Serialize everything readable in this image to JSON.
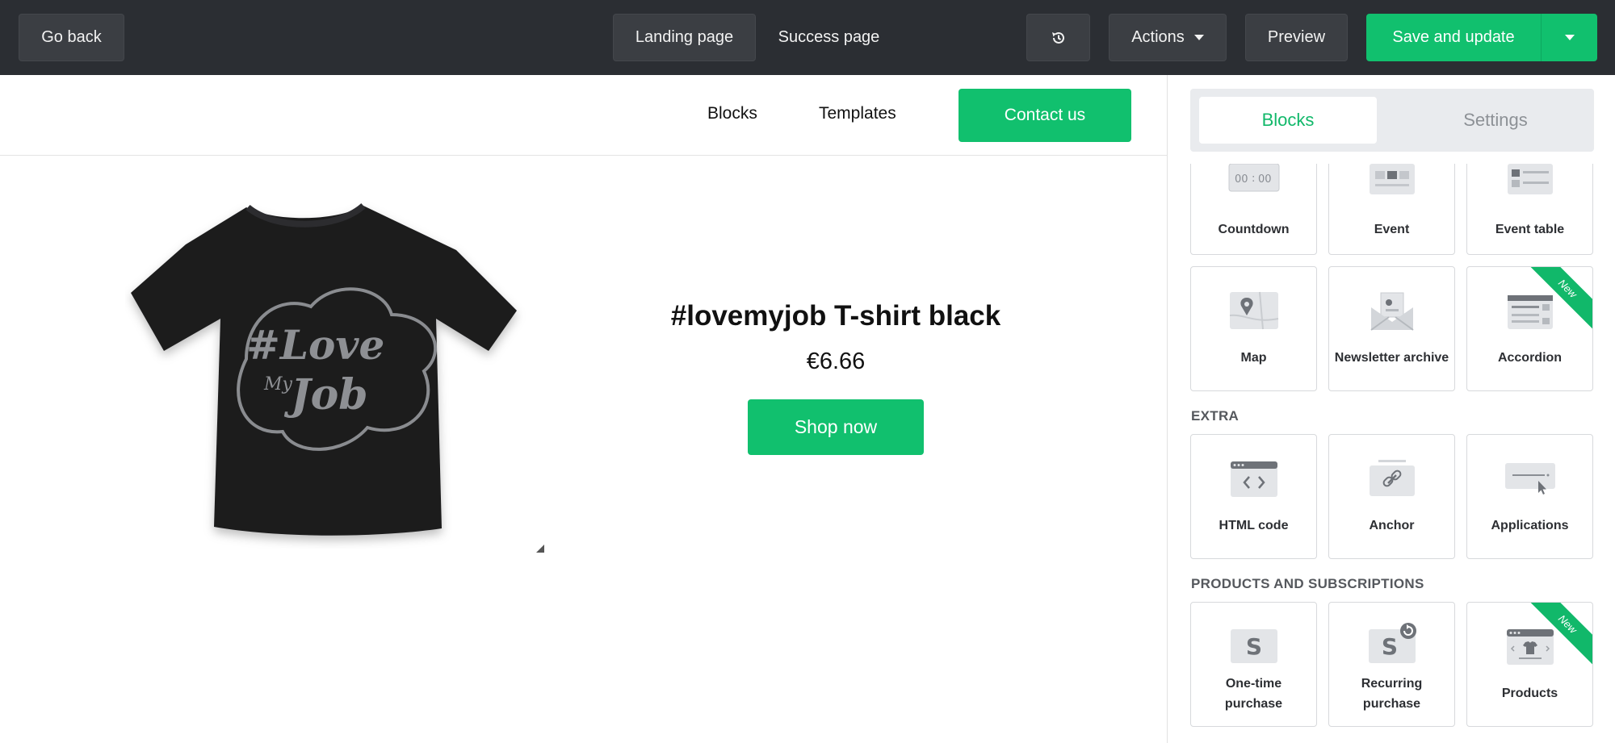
{
  "topbar": {
    "go_back": "Go back",
    "page_tabs": [
      "Landing page",
      "Success page"
    ],
    "history_icon": "history-icon",
    "actions": "Actions",
    "preview": "Preview",
    "save": "Save and update"
  },
  "site": {
    "nav": [
      "Blocks",
      "Templates"
    ],
    "contact": "Contact us",
    "product_title": "#lovemyjob T-shirt black",
    "product_price": "€6.66",
    "shop_button": "Shop now",
    "tshirt_print": [
      "#Love",
      "My",
      "Job"
    ]
  },
  "panel": {
    "tabs": [
      "Blocks",
      "Settings"
    ],
    "row1": [
      {
        "label": "Countdown",
        "icon": "countdown-icon",
        "countdown_digits": [
          "00",
          ":",
          "00"
        ]
      },
      {
        "label": "Event",
        "icon": "event-icon"
      },
      {
        "label": "Event table",
        "icon": "event-table-icon"
      }
    ],
    "row2": [
      {
        "label": "Map",
        "icon": "map-icon"
      },
      {
        "label": "Newsletter archive",
        "icon": "newsletter-archive-icon"
      },
      {
        "label": "Accordion",
        "icon": "accordion-icon",
        "badge": "New"
      }
    ],
    "extra_title": "EXTRA",
    "extra": [
      {
        "label": "HTML code",
        "icon": "html-code-icon"
      },
      {
        "label": "Anchor",
        "icon": "anchor-link-icon"
      },
      {
        "label": "Applications",
        "icon": "applications-icon"
      }
    ],
    "products_title": "PRODUCTS AND SUBSCRIPTIONS",
    "products": [
      {
        "label_lines": [
          "One-time",
          "purchase"
        ],
        "icon": "one-time-purchase-icon",
        "glyph": "S"
      },
      {
        "label_lines": [
          "Recurring",
          "purchase"
        ],
        "icon": "recurring-purchase-icon",
        "glyph": "S"
      },
      {
        "label": "Products",
        "icon": "products-icon",
        "badge": "New"
      }
    ]
  }
}
